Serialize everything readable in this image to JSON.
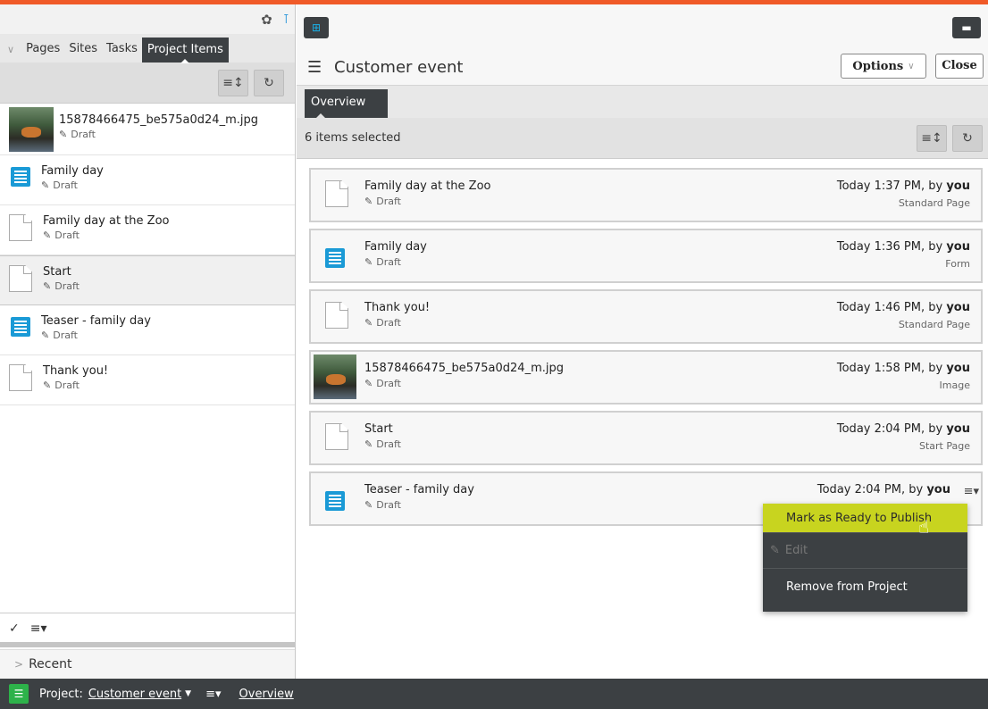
{
  "left": {
    "tabs": [
      "Pages",
      "Sites",
      "Tasks",
      "Project Items"
    ],
    "items": [
      {
        "name": "15878466475_be575a0d24_m.jpg",
        "status": "Draft",
        "icon": "image-thumbnail"
      },
      {
        "name": "Family day",
        "status": "Draft",
        "icon": "form-icon"
      },
      {
        "name": "Family day at the Zoo",
        "status": "Draft",
        "icon": "page-icon"
      },
      {
        "name": "Start",
        "status": "Draft",
        "icon": "page-icon"
      },
      {
        "name": "Teaser - family day",
        "status": "Draft",
        "icon": "form-icon"
      },
      {
        "name": "Thank you!",
        "status": "Draft",
        "icon": "page-icon"
      }
    ],
    "recent": "Recent"
  },
  "main": {
    "title": "Customer event",
    "options_label": "Options",
    "close_label": "Close",
    "tab": "Overview",
    "selected_text": "6 items selected",
    "cards": [
      {
        "name": "Family day at the Zoo",
        "status": "Draft",
        "time": "Today 1:37 PM, by ",
        "user": "you",
        "type": "Standard Page",
        "icon": "page-icon"
      },
      {
        "name": "Family day",
        "status": "Draft",
        "time": "Today 1:36 PM, by ",
        "user": "you",
        "type": "Form",
        "icon": "form-icon"
      },
      {
        "name": "Thank you!",
        "status": "Draft",
        "time": "Today 1:46 PM, by ",
        "user": "you",
        "type": "Standard Page",
        "icon": "page-icon"
      },
      {
        "name": "15878466475_be575a0d24_m.jpg",
        "status": "Draft",
        "time": "Today 1:58 PM, by ",
        "user": "you",
        "type": "Image",
        "icon": "image-thumbnail"
      },
      {
        "name": "Start",
        "status": "Draft",
        "time": "Today 2:04 PM, by ",
        "user": "you",
        "type": "Start Page",
        "icon": "page-icon"
      },
      {
        "name": "Teaser - family day",
        "status": "Draft",
        "time": "Today 2:04 PM, by ",
        "user": "you",
        "type": "",
        "icon": "form-icon"
      }
    ]
  },
  "context_menu": {
    "items": [
      "Mark as Ready to Publish",
      "Edit",
      "Remove from Project"
    ]
  },
  "bottom": {
    "project_label": "Project:",
    "project_name": "Customer event",
    "overview_link": "Overview"
  },
  "colors": {
    "accent": "#f05a28",
    "dark": "#3c4043",
    "highlight": "#c8d41f",
    "form_blue": "#1a9ad6",
    "project_green": "#2db24a"
  }
}
